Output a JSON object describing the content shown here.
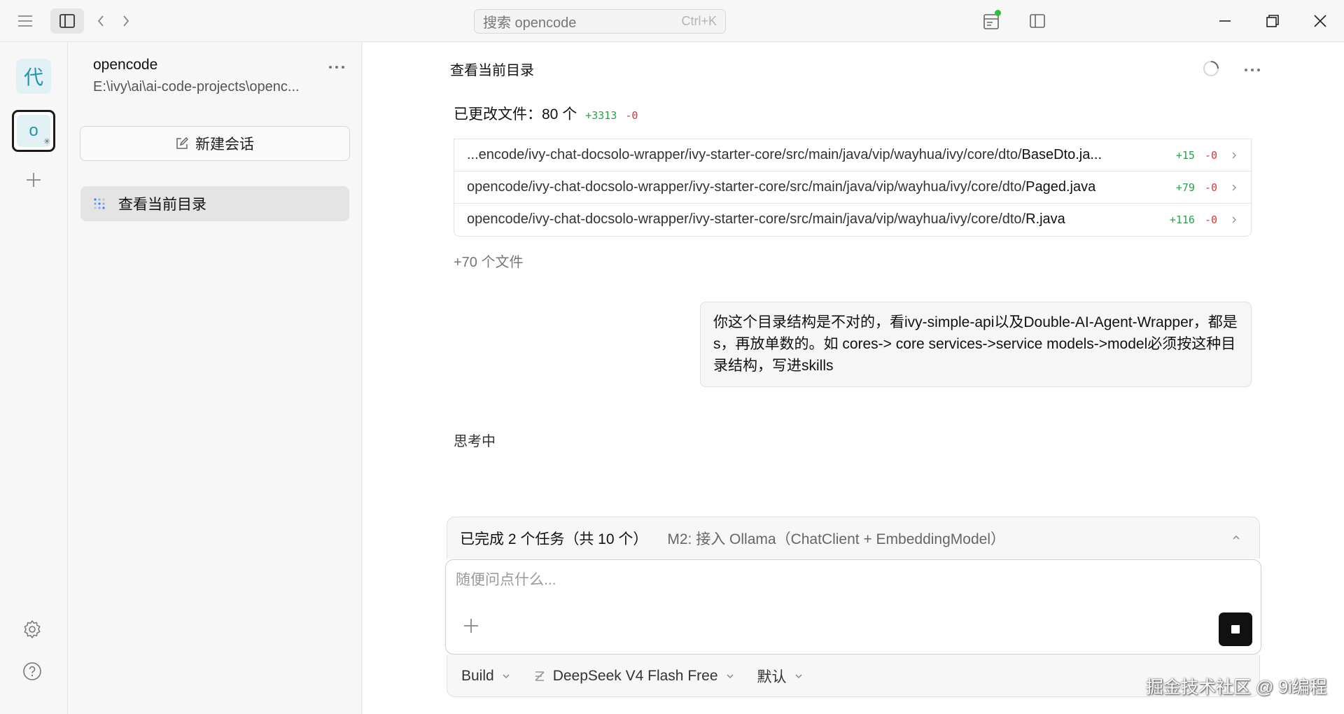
{
  "topbar": {
    "search_placeholder": "搜索 opencode",
    "search_shortcut": "Ctrl+K"
  },
  "colors": {
    "accent_teal": "#2296ad",
    "additions": "#27a34a",
    "deletions": "#d23a3a",
    "status_dot": "#2fbf3a"
  },
  "rail": {
    "project_a_glyph": "代",
    "project_b_glyph": "o"
  },
  "sidebar": {
    "project_name": "opencode",
    "project_path": "E:\\ivy\\ai\\ai-code-projects\\openc...",
    "new_session_label": "新建会话",
    "sessions": [
      {
        "title": "查看当前目录"
      }
    ]
  },
  "main": {
    "title": "查看当前目录",
    "changed_label": "已更改文件：80 个",
    "changed_additions": "+3313",
    "changed_deletions": "-0",
    "files": [
      {
        "prefix": "...encode/ivy-chat-docsolo-wrapper/ivy-starter-core/src/main/java/vip/wayhua/ivy/core/dto/",
        "name": "BaseDto.ja...",
        "additions": "+15",
        "deletions": "-0"
      },
      {
        "prefix": "opencode/ivy-chat-docsolo-wrapper/ivy-starter-core/src/main/java/vip/wayhua/ivy/core/dto/",
        "name": "Paged.java",
        "additions": "+79",
        "deletions": "-0"
      },
      {
        "prefix": "opencode/ivy-chat-docsolo-wrapper/ivy-starter-core/src/main/java/vip/wayhua/ivy/core/dto/",
        "name": "R.java",
        "additions": "+116",
        "deletions": "-0"
      }
    ],
    "more_files": "+70 个文件",
    "user_message": "你这个目录结构是不对的，看ivy-simple-api以及Double-AI-Agent-Wrapper，都是s，再放单数的。如 cores-> core  services->service  models->model必须按这种目录结构，写进skills",
    "thinking": "思考中"
  },
  "tasks": {
    "done_label": "已完成 2 个任务（共 10 个）",
    "current": "M2: 接入 Ollama（ChatClient + EmbeddingModel）"
  },
  "composer": {
    "placeholder": "随便问点什么..."
  },
  "options": {
    "agent": "Build",
    "model": "DeepSeek V4 Flash Free",
    "variant": "默认"
  },
  "watermark": "掘金技术社区 @ 9i编程"
}
